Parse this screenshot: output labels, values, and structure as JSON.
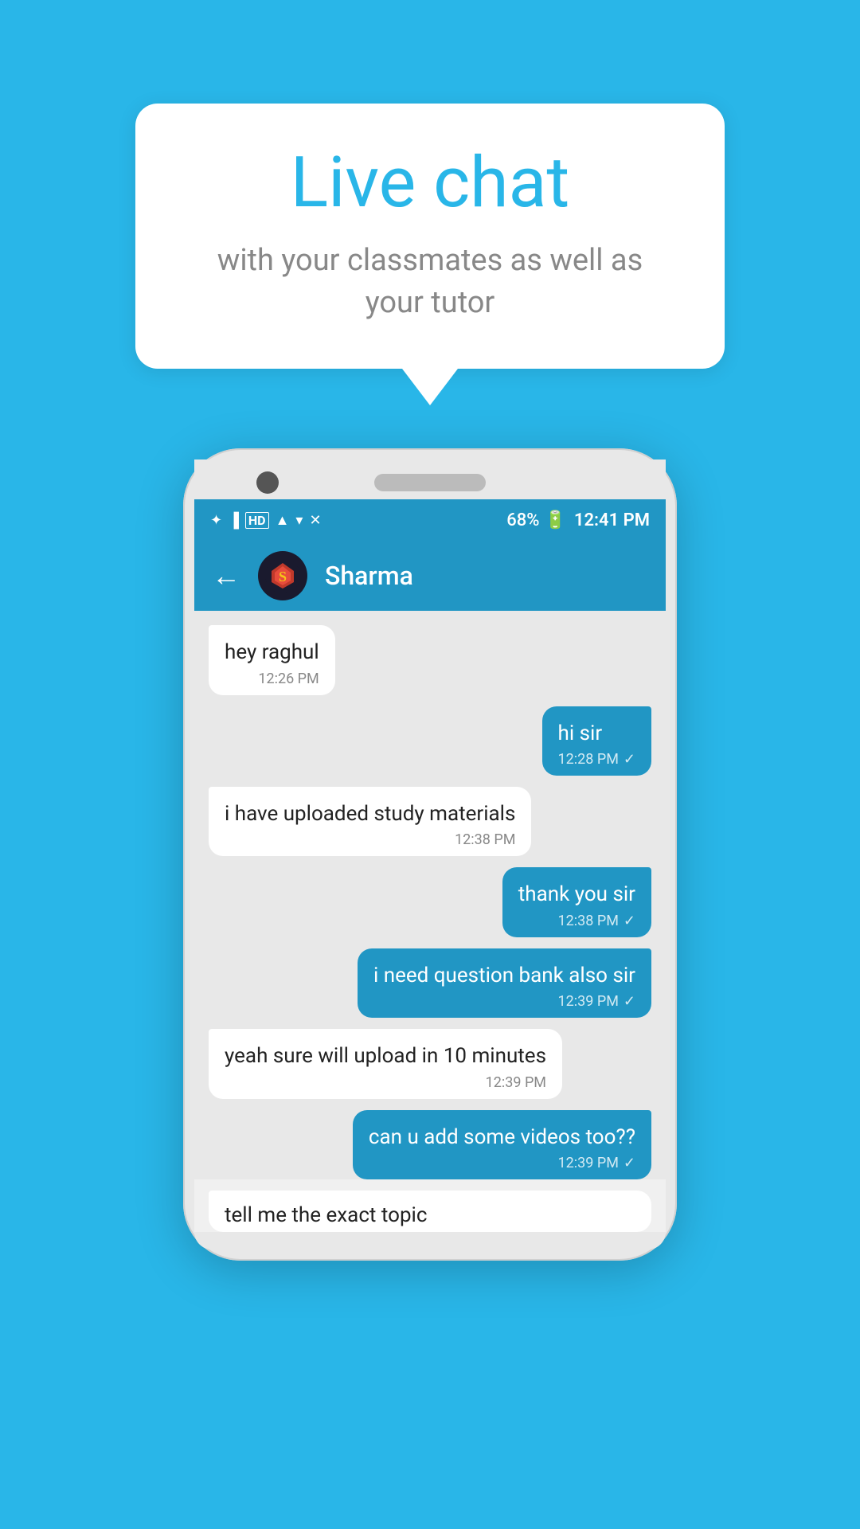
{
  "background_color": "#29b6e8",
  "bubble": {
    "title": "Live chat",
    "subtitle": "with your classmates as well as your tutor"
  },
  "phone": {
    "status_bar": {
      "left_icons": "bluetooth signal HD wifi data",
      "battery": "68%",
      "time": "12:41 PM"
    },
    "app_bar": {
      "contact_name": "Sharma",
      "back_label": "←"
    },
    "messages": [
      {
        "id": "msg1",
        "type": "received",
        "text": "hey raghul",
        "time": "12:26 PM",
        "ticks": ""
      },
      {
        "id": "msg2",
        "type": "sent",
        "text": "hi sir",
        "time": "12:28 PM",
        "ticks": "✓"
      },
      {
        "id": "msg3",
        "type": "received",
        "text": "i have uploaded study materials",
        "time": "12:38 PM",
        "ticks": ""
      },
      {
        "id": "msg4",
        "type": "sent",
        "text": "thank you sir",
        "time": "12:38 PM",
        "ticks": "✓"
      },
      {
        "id": "msg5",
        "type": "sent",
        "text": "i need question bank also sir",
        "time": "12:39 PM",
        "ticks": "✓"
      },
      {
        "id": "msg6",
        "type": "received",
        "text": "yeah sure will upload in 10 minutes",
        "time": "12:39 PM",
        "ticks": ""
      },
      {
        "id": "msg7",
        "type": "sent",
        "text": "can u add some videos too??",
        "time": "12:39 PM",
        "ticks": "✓"
      }
    ],
    "partial_message": {
      "text": "tell me the exact topic"
    }
  }
}
